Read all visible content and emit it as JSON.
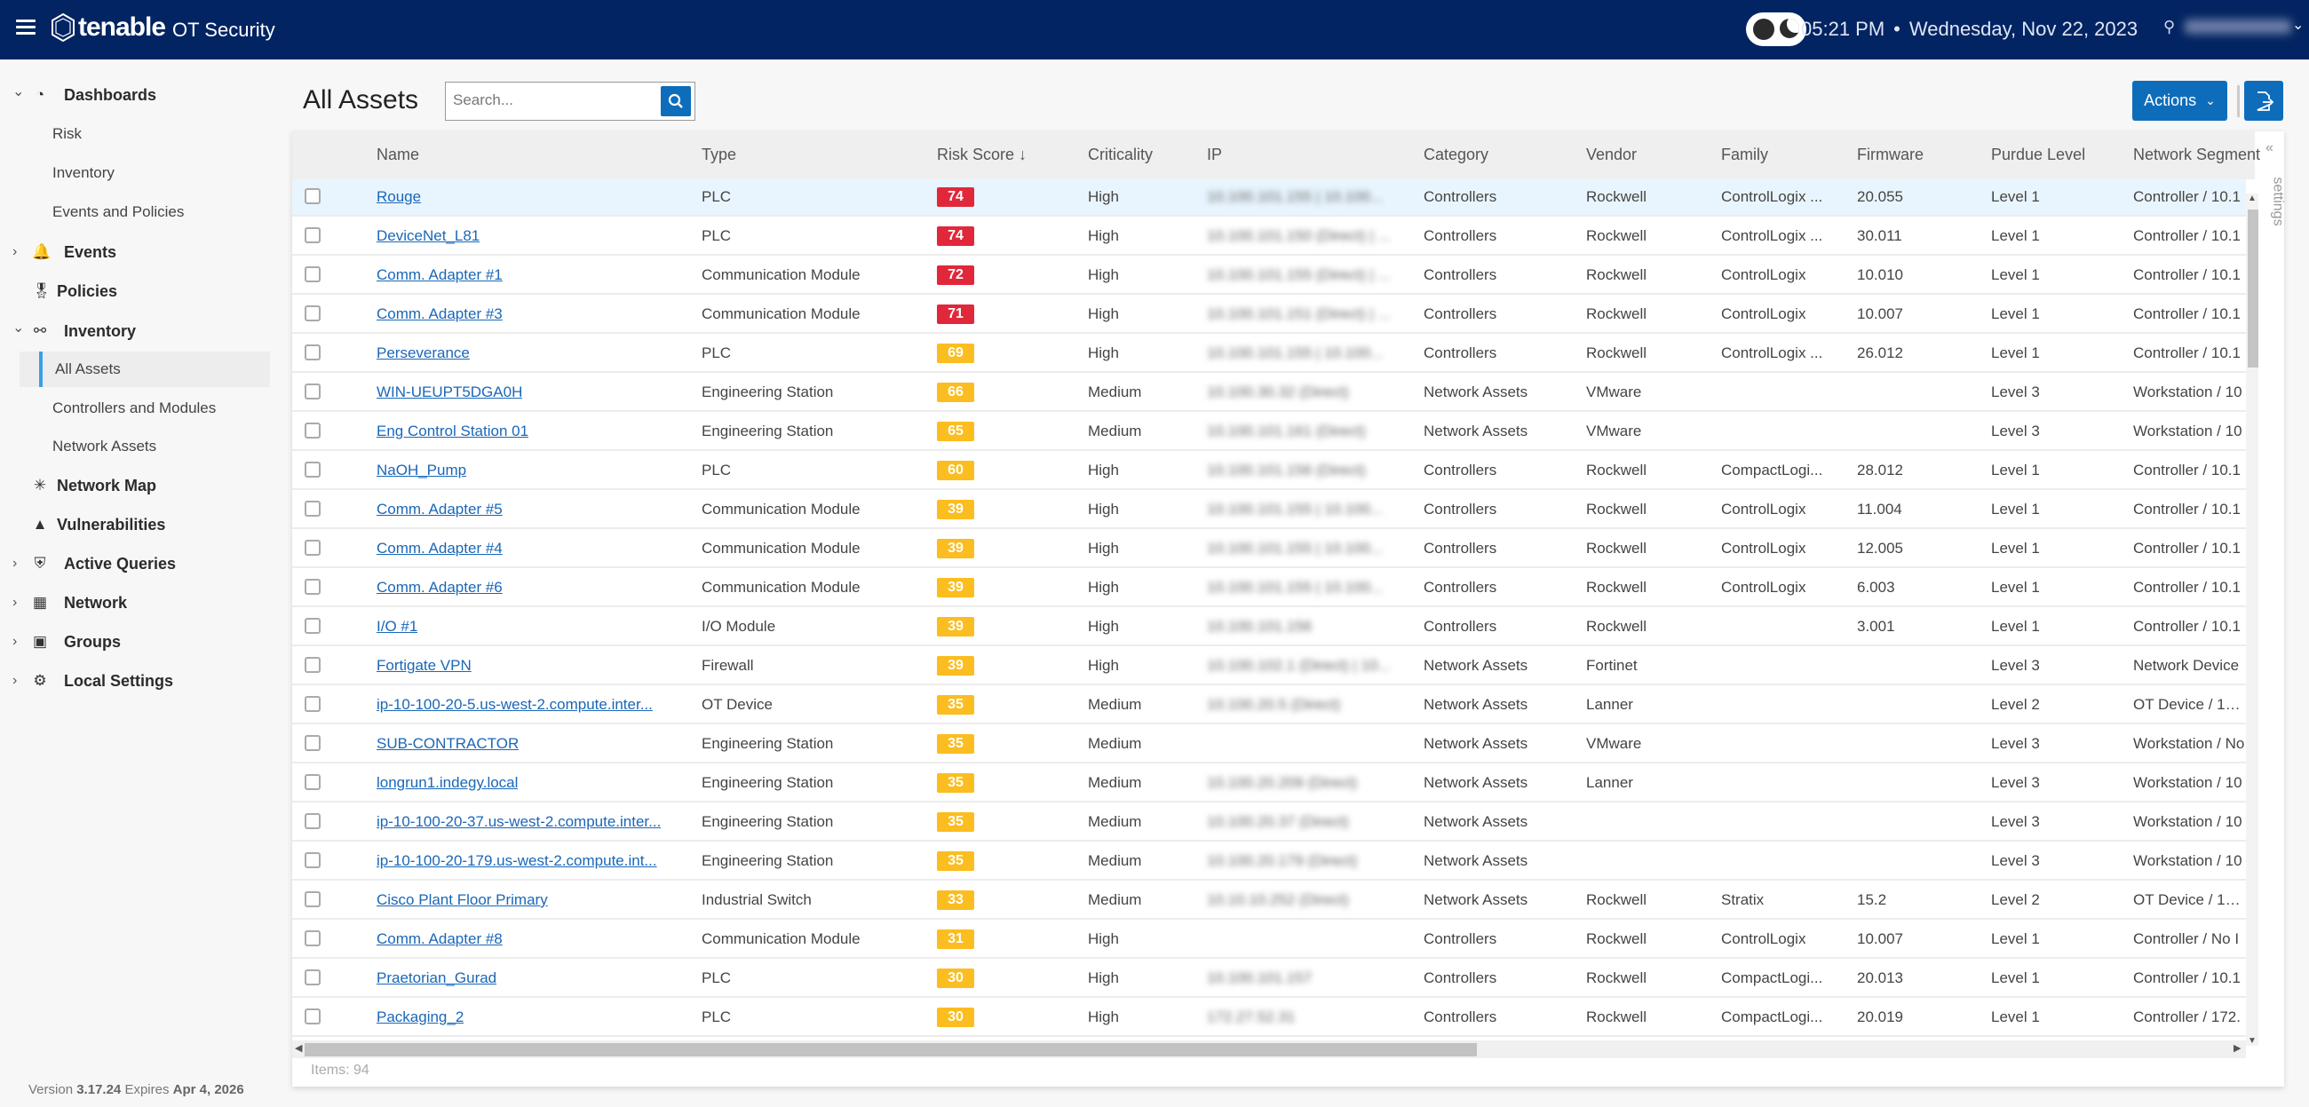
{
  "topbar": {
    "brand": "tenable",
    "product": "OT Security",
    "time": "05:21 PM",
    "separator": "•",
    "date": "Wednesday, Nov 22, 2023",
    "user_name": "[redacted]"
  },
  "sidebar": {
    "items": [
      {
        "label": "Dashboards",
        "icon": "dashboard-gauge-icon",
        "caret": "expanded"
      },
      {
        "label": "Risk",
        "sub": true
      },
      {
        "label": "Inventory",
        "sub": true
      },
      {
        "label": "Events and Policies",
        "sub": true
      },
      {
        "label": "Events",
        "icon": "bell-icon",
        "caret": "collapsed"
      },
      {
        "label": "Policies",
        "icon": "policy-badge-icon"
      },
      {
        "label": "Inventory",
        "icon": "inventory-icon",
        "caret": "expanded"
      },
      {
        "label": "All Assets",
        "sub": true,
        "active": true
      },
      {
        "label": "Controllers and Modules",
        "sub": true
      },
      {
        "label": "Network Assets",
        "sub": true
      },
      {
        "label": "Network Map",
        "icon": "network-map-icon"
      },
      {
        "label": "Vulnerabilities",
        "icon": "siren-icon"
      },
      {
        "label": "Active Queries",
        "icon": "shield-icon",
        "caret": "collapsed"
      },
      {
        "label": "Network",
        "icon": "network-icon",
        "caret": "collapsed"
      },
      {
        "label": "Groups",
        "icon": "groups-box-icon",
        "caret": "collapsed"
      },
      {
        "label": "Local Settings",
        "icon": "gears-icon",
        "caret": "collapsed"
      }
    ],
    "version_prefix": "Version",
    "version": "3.17.24",
    "expires_prefix": "Expires",
    "expires": "Apr 4, 2026"
  },
  "page": {
    "title": "All Assets",
    "search_placeholder": "Search...",
    "actions_label": "Actions",
    "settings_label": "settings",
    "items_label": "Items: 94"
  },
  "colors": {
    "topbar": "#032462",
    "primary": "#0e6dbb",
    "risk_high": "#e0283a",
    "risk_medium": "#fbbd1f",
    "link": "#1a67b8"
  },
  "table": {
    "columns": [
      "Name",
      "Type",
      "Risk Score ↓",
      "Criticality",
      "IP",
      "Category",
      "Vendor",
      "Family",
      "Firmware",
      "Purdue Level",
      "Network Segment"
    ],
    "rows": [
      {
        "name": "Rouge",
        "type": "PLC",
        "risk": "74",
        "level": "high",
        "crit": "High",
        "ip": "10.100.101.155 | 10.100...",
        "cat": "Controllers",
        "vendor": "Rockwell",
        "family": "ControlLogix ...",
        "fw": "20.055",
        "purdue": "Level 1",
        "seg": "Controller / 10.1",
        "selected": true
      },
      {
        "name": "DeviceNet_L81",
        "type": "PLC",
        "risk": "74",
        "level": "high",
        "crit": "High",
        "ip": "10.100.101.150 (Direct) | ...",
        "cat": "Controllers",
        "vendor": "Rockwell",
        "family": "ControlLogix ...",
        "fw": "30.011",
        "purdue": "Level 1",
        "seg": "Controller / 10.1"
      },
      {
        "name": "Comm. Adapter #1",
        "type": "Communication Module",
        "risk": "72",
        "level": "high",
        "crit": "High",
        "ip": "10.100.101.155 (Direct) | ...",
        "cat": "Controllers",
        "vendor": "Rockwell",
        "family": "ControlLogix",
        "fw": "10.010",
        "purdue": "Level 1",
        "seg": "Controller / 10.1"
      },
      {
        "name": "Comm. Adapter #3",
        "type": "Communication Module",
        "risk": "71",
        "level": "high",
        "crit": "High",
        "ip": "10.100.101.151 (Direct) | ...",
        "cat": "Controllers",
        "vendor": "Rockwell",
        "family": "ControlLogix",
        "fw": "10.007",
        "purdue": "Level 1",
        "seg": "Controller / 10.1"
      },
      {
        "name": "Perseverance",
        "type": "PLC",
        "risk": "69",
        "level": "medium",
        "crit": "High",
        "ip": "10.100.101.155 | 10.100...",
        "cat": "Controllers",
        "vendor": "Rockwell",
        "family": "ControlLogix ...",
        "fw": "26.012",
        "purdue": "Level 1",
        "seg": "Controller / 10.1"
      },
      {
        "name": "WIN-UEUPT5DGA0H",
        "type": "Engineering Station",
        "risk": "66",
        "level": "medium",
        "crit": "Medium",
        "ip": "10.100.30.32 (Direct)",
        "cat": "Network Assets",
        "vendor": "VMware",
        "family": "",
        "fw": "",
        "purdue": "Level 3",
        "seg": "Workstation / 10"
      },
      {
        "name": "Eng Control Station 01",
        "type": "Engineering Station",
        "risk": "65",
        "level": "medium",
        "crit": "Medium",
        "ip": "10.100.101.161 (Direct)",
        "cat": "Network Assets",
        "vendor": "VMware",
        "family": "",
        "fw": "",
        "purdue": "Level 3",
        "seg": "Workstation / 10"
      },
      {
        "name": "NaOH_Pump",
        "type": "PLC",
        "risk": "60",
        "level": "medium",
        "crit": "High",
        "ip": "10.100.101.156 (Direct)",
        "cat": "Controllers",
        "vendor": "Rockwell",
        "family": "CompactLogi...",
        "fw": "28.012",
        "purdue": "Level 1",
        "seg": "Controller / 10.1"
      },
      {
        "name": "Comm. Adapter #5",
        "type": "Communication Module",
        "risk": "39",
        "level": "medium",
        "crit": "High",
        "ip": "10.100.101.155 | 10.100...",
        "cat": "Controllers",
        "vendor": "Rockwell",
        "family": "ControlLogix",
        "fw": "11.004",
        "purdue": "Level 1",
        "seg": "Controller / 10.1"
      },
      {
        "name": "Comm. Adapter #4",
        "type": "Communication Module",
        "risk": "39",
        "level": "medium",
        "crit": "High",
        "ip": "10.100.101.155 | 10.100...",
        "cat": "Controllers",
        "vendor": "Rockwell",
        "family": "ControlLogix",
        "fw": "12.005",
        "purdue": "Level 1",
        "seg": "Controller / 10.1"
      },
      {
        "name": "Comm. Adapter #6",
        "type": "Communication Module",
        "risk": "39",
        "level": "medium",
        "crit": "High",
        "ip": "10.100.101.155 | 10.100...",
        "cat": "Controllers",
        "vendor": "Rockwell",
        "family": "ControlLogix",
        "fw": "6.003",
        "purdue": "Level 1",
        "seg": "Controller / 10.1"
      },
      {
        "name": "I/O #1",
        "type": "I/O Module",
        "risk": "39",
        "level": "medium",
        "crit": "High",
        "ip": "10.100.101.156",
        "cat": "Controllers",
        "vendor": "Rockwell",
        "family": "",
        "fw": "3.001",
        "purdue": "Level 1",
        "seg": "Controller / 10.1"
      },
      {
        "name": "Fortigate VPN",
        "type": "Firewall",
        "risk": "39",
        "level": "medium",
        "crit": "High",
        "ip": "10.100.102.1 (Direct) | 10...",
        "cat": "Network Assets",
        "vendor": "Fortinet",
        "family": "",
        "fw": "",
        "purdue": "Level 3",
        "seg": "Network Device"
      },
      {
        "name": "ip-10-100-20-5.us-west-2.compute.inter...",
        "type": "OT Device",
        "risk": "35",
        "level": "medium",
        "crit": "Medium",
        "ip": "10.100.20.5 (Direct)",
        "cat": "Network Assets",
        "vendor": "Lanner",
        "family": "",
        "fw": "",
        "purdue": "Level 2",
        "seg": "OT Device / 10.1"
      },
      {
        "name": "SUB-CONTRACTOR",
        "type": "Engineering Station",
        "risk": "35",
        "level": "medium",
        "crit": "Medium",
        "ip": "",
        "cat": "Network Assets",
        "vendor": "VMware",
        "family": "",
        "fw": "",
        "purdue": "Level 3",
        "seg": "Workstation / No"
      },
      {
        "name": "longrun1.indegy.local",
        "type": "Engineering Station",
        "risk": "35",
        "level": "medium",
        "crit": "Medium",
        "ip": "10.100.20.209 (Direct)",
        "cat": "Network Assets",
        "vendor": "Lanner",
        "family": "",
        "fw": "",
        "purdue": "Level 3",
        "seg": "Workstation / 10"
      },
      {
        "name": "ip-10-100-20-37.us-west-2.compute.inter...",
        "type": "Engineering Station",
        "risk": "35",
        "level": "medium",
        "crit": "Medium",
        "ip": "10.100.20.37 (Direct)",
        "cat": "Network Assets",
        "vendor": "",
        "family": "",
        "fw": "",
        "purdue": "Level 3",
        "seg": "Workstation / 10"
      },
      {
        "name": "ip-10-100-20-179.us-west-2.compute.int...",
        "type": "Engineering Station",
        "risk": "35",
        "level": "medium",
        "crit": "Medium",
        "ip": "10.100.20.179 (Direct)",
        "cat": "Network Assets",
        "vendor": "",
        "family": "",
        "fw": "",
        "purdue": "Level 3",
        "seg": "Workstation / 10"
      },
      {
        "name": "Cisco Plant Floor Primary",
        "type": "Industrial Switch",
        "risk": "33",
        "level": "medium",
        "crit": "Medium",
        "ip": "10.10.10.252 (Direct)",
        "cat": "Network Assets",
        "vendor": "Rockwell",
        "family": "Stratix",
        "fw": "15.2",
        "purdue": "Level 2",
        "seg": "OT Device / 10.1"
      },
      {
        "name": "Comm. Adapter #8",
        "type": "Communication Module",
        "risk": "31",
        "level": "medium",
        "crit": "High",
        "ip": "",
        "cat": "Controllers",
        "vendor": "Rockwell",
        "family": "ControlLogix",
        "fw": "10.007",
        "purdue": "Level 1",
        "seg": "Controller / No I"
      },
      {
        "name": "Praetorian_Gurad",
        "type": "PLC",
        "risk": "30",
        "level": "medium",
        "crit": "High",
        "ip": "10.100.101.157",
        "cat": "Controllers",
        "vendor": "Rockwell",
        "family": "CompactLogi...",
        "fw": "20.013",
        "purdue": "Level 1",
        "seg": "Controller / 10.1"
      },
      {
        "name": "Packaging_2",
        "type": "PLC",
        "risk": "30",
        "level": "medium",
        "crit": "High",
        "ip": "172.27.52.31",
        "cat": "Controllers",
        "vendor": "Rockwell",
        "family": "CompactLogi...",
        "fw": "20.019",
        "purdue": "Level 1",
        "seg": "Controller / 172."
      }
    ]
  }
}
